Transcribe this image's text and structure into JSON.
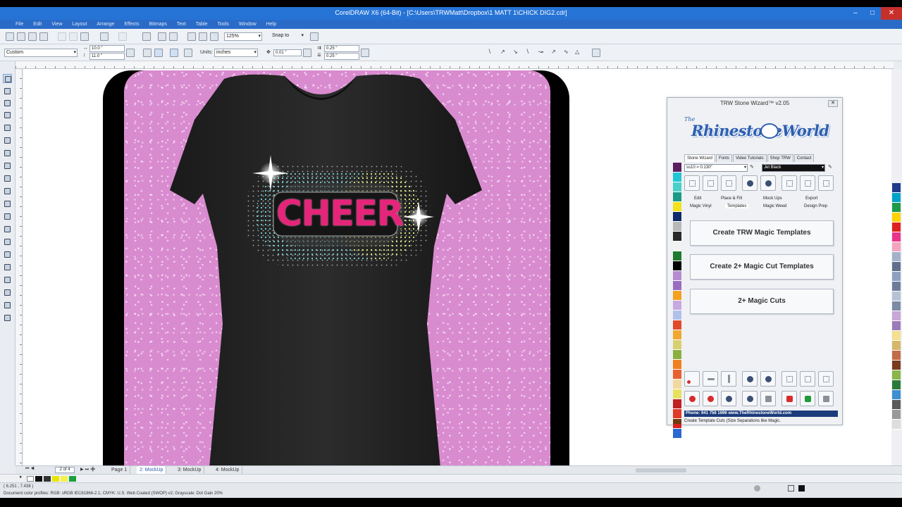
{
  "window": {
    "title": "CorelDRAW X6 (64-Bit) - [C:\\Users\\TRWMatt\\Dropbox\\1 MATT 1\\CHICK DIG2.cdr]"
  },
  "menu": [
    "File",
    "Edit",
    "View",
    "Layout",
    "Arrange",
    "Effects",
    "Bitmaps",
    "Text",
    "Table",
    "Tools",
    "Window",
    "Help"
  ],
  "toolbar": {
    "zoom": "125%",
    "snap": "Snap to"
  },
  "property_bar": {
    "preset": "Custom",
    "width": "10.0 \"",
    "height": "11.0 \"",
    "units_label": "Units:",
    "units": "inches",
    "nudge": "0.01 \"",
    "dup_x": "0.25 \"",
    "dup_y": "0.25 \""
  },
  "artwork": {
    "text": "CHEER"
  },
  "page_tabs": {
    "counter": "2 of 4",
    "tabs": [
      "Page 1",
      "2: MockUp",
      "3: MockUp",
      "4: MockUp"
    ],
    "active_index": 1
  },
  "status": {
    "coords": "( 6.251 , 7.438 )",
    "profile": "Document color profiles: RGB: sRGB IEC61966-2.1; CMYK: U.S. Web Coated (SWOP) v2; Grayscale: Dot Gain 20%"
  },
  "plugin": {
    "title": "TRW Stone Wizard™ v2.05",
    "logo_the": "The",
    "logo_text": "RhinestoneWorld",
    "tabs": [
      "Stone Wizard",
      "Fonts",
      "Video Tutorials",
      "Shop TRW",
      "Contact"
    ],
    "active_tab": 0,
    "stone_size": "ss10 = 0.130\"",
    "stone_color": "Jet Black",
    "functions_row1": [
      "Edit",
      "Place & Fill",
      "Mock Ups",
      "Export"
    ],
    "functions_row2": [
      "Magic Vinyl",
      "Templates",
      "Magic Weed",
      "Design Prep"
    ],
    "buttons": [
      "Create TRW Magic Templates",
      "Create 2+ Magic Cut Templates",
      "2+ Magic Cuts"
    ],
    "footer": "Phone: 941 756 1696    www.TheRhinestoneWorld.com",
    "hint": "Create Template Cuts (Size Separations like Magic."
  },
  "colors": {
    "accent": "#2673d6",
    "pink_glitter": "#d98bd0",
    "cheer_pink": "#e6247a"
  }
}
